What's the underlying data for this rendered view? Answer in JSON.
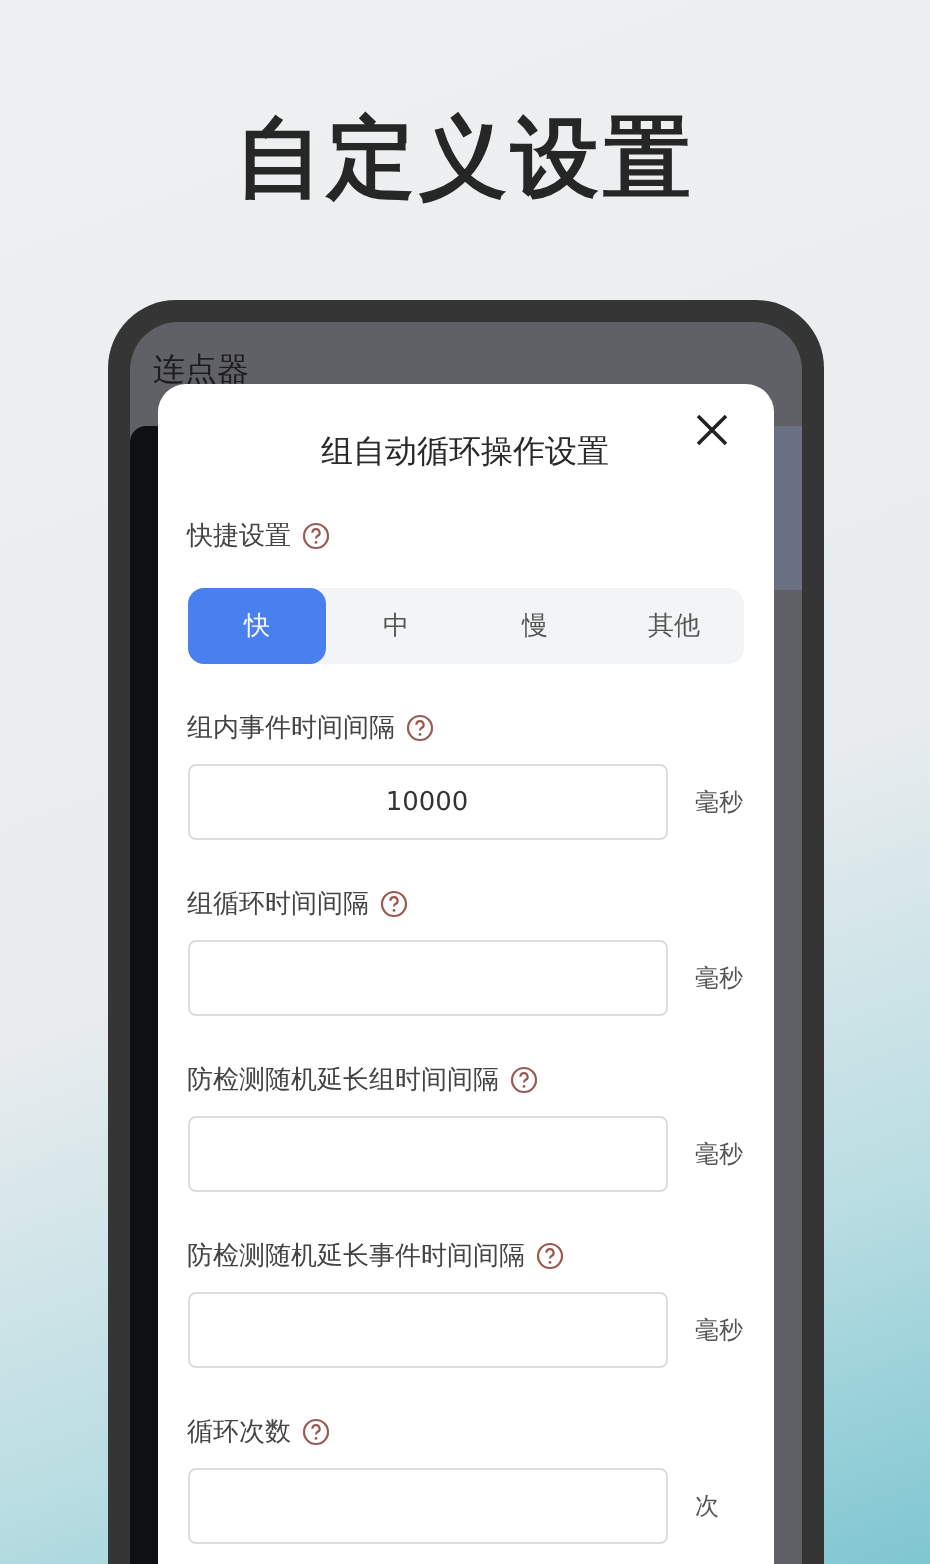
{
  "heading": "自定义设置",
  "app_title": "连点器",
  "dialog": {
    "title": "组自动循环操作设置",
    "quick": {
      "label": "快捷设置",
      "options": [
        {
          "label": "快",
          "selected": true
        },
        {
          "label": "中",
          "selected": false
        },
        {
          "label": "慢",
          "selected": false
        },
        {
          "label": "其他",
          "selected": false
        }
      ]
    },
    "fields": [
      {
        "label": "组内事件时间间隔",
        "value": "10000",
        "unit": "毫秒"
      },
      {
        "label": "组循环时间间隔",
        "unit": "毫秒"
      },
      {
        "label": "防检测随机延长组时间间隔",
        "unit": "毫秒"
      },
      {
        "label": "防检测随机延长事件时间间隔",
        "unit": "毫秒"
      },
      {
        "label": "循环次数",
        "unit": "次"
      }
    ]
  }
}
